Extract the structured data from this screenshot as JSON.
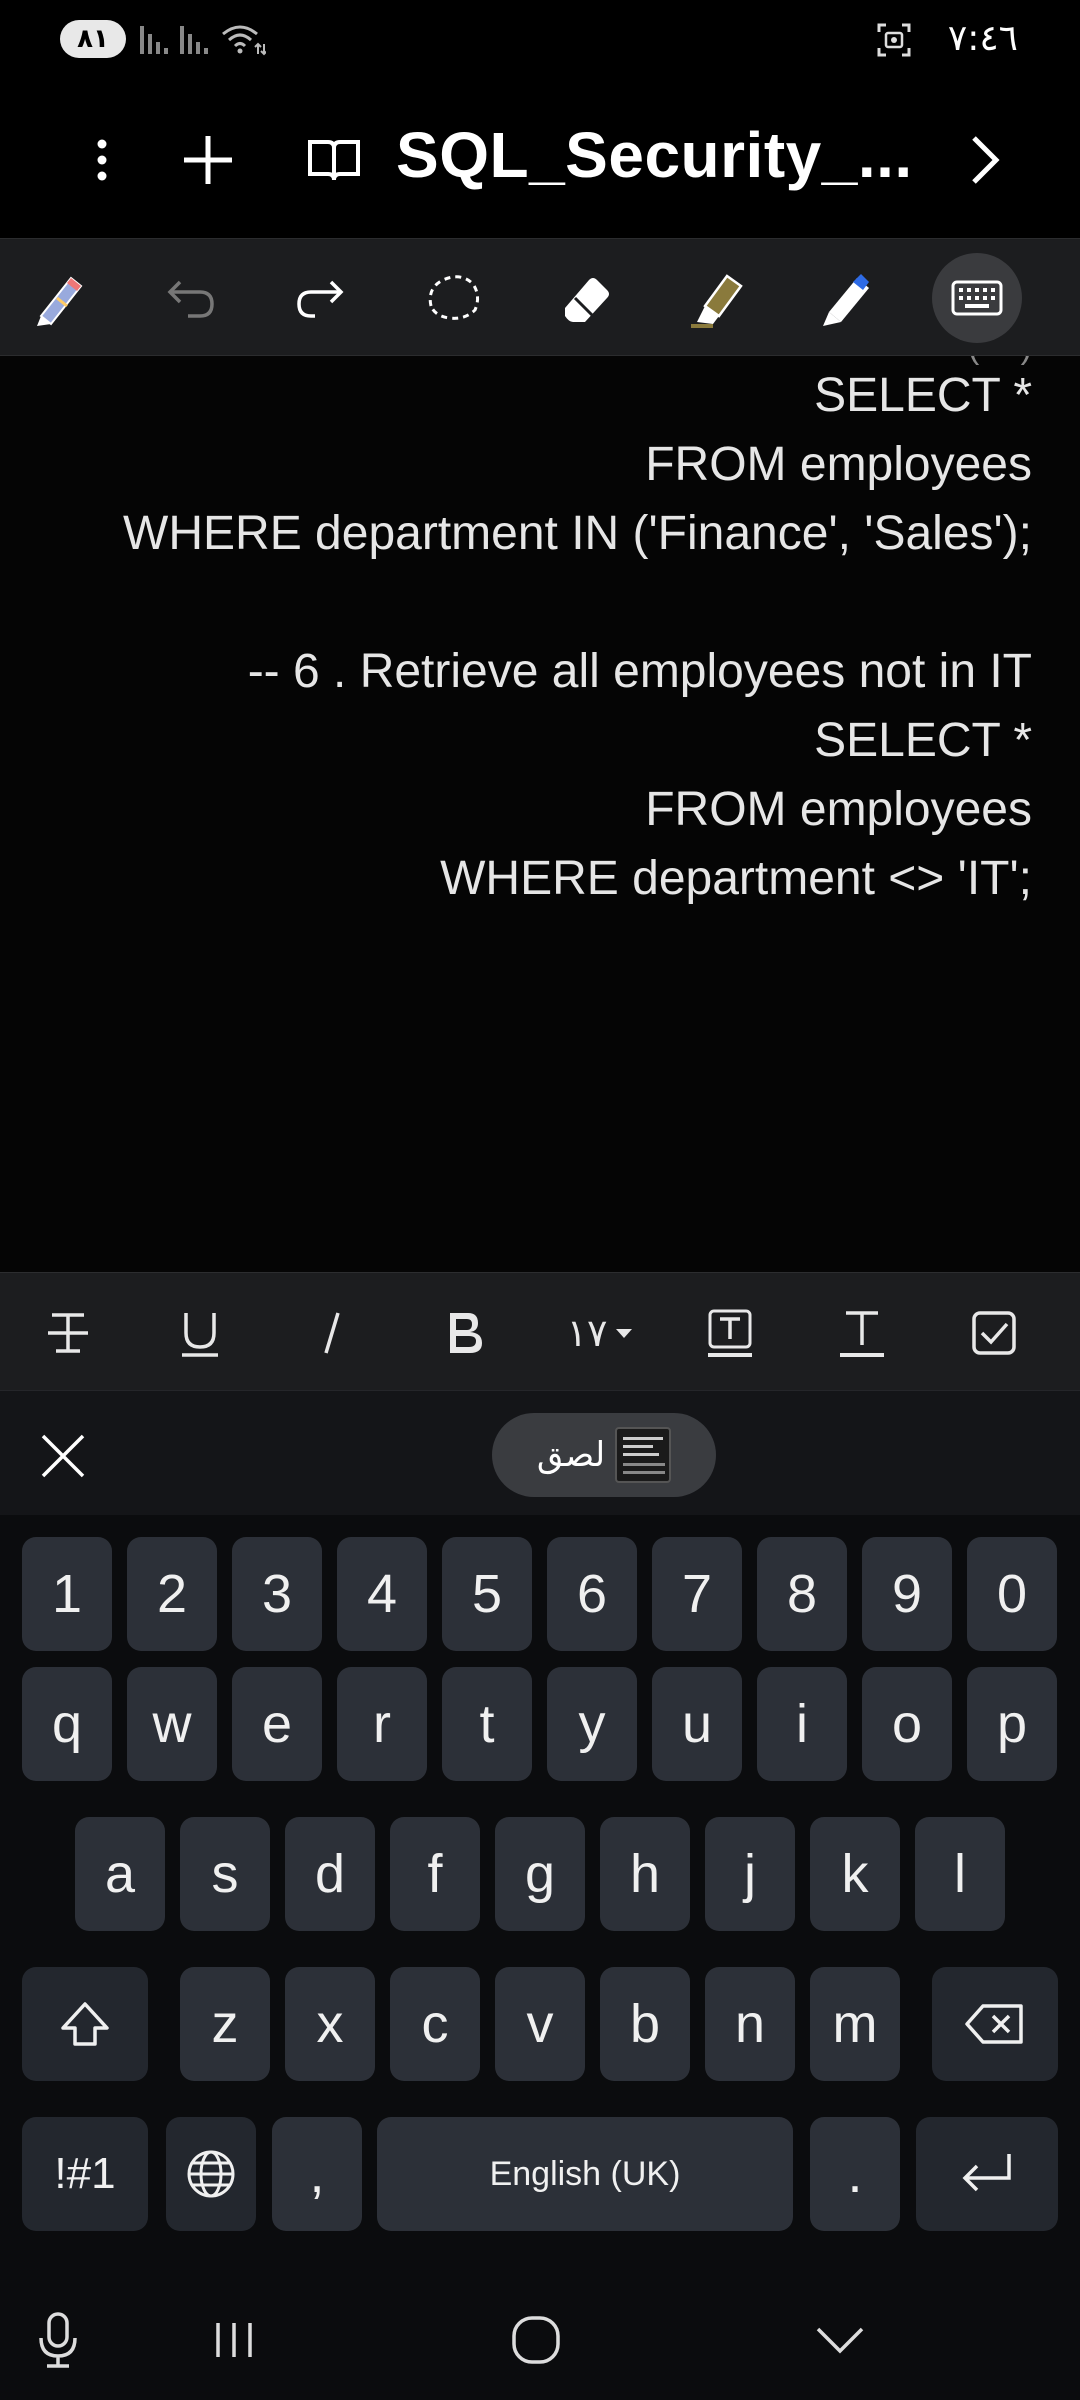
{
  "status_bar": {
    "battery": "٨١",
    "time": "٧:٤٦"
  },
  "app_bar": {
    "title": "SQL_Security_..."
  },
  "note": {
    "lines": [
      "SELECT *",
      "FROM employees",
      "WHERE department IN ('Finance', 'Sales');",
      "",
      "-- 6 . Retrieve all employees not in IT",
      "SELECT *",
      "FROM employees",
      "WHERE department <> 'IT';"
    ]
  },
  "format_bar": {
    "font_size": "١٧"
  },
  "keyboard": {
    "paste_label": "لصق",
    "rows": {
      "numbers": [
        "1",
        "2",
        "3",
        "4",
        "5",
        "6",
        "7",
        "8",
        "9",
        "0"
      ],
      "row1": [
        "q",
        "w",
        "e",
        "r",
        "t",
        "y",
        "u",
        "i",
        "o",
        "p"
      ],
      "row2": [
        "a",
        "s",
        "d",
        "f",
        "g",
        "h",
        "j",
        "k",
        "l"
      ],
      "row3": [
        "z",
        "x",
        "c",
        "v",
        "b",
        "n",
        "m"
      ]
    },
    "symbols_label": "!#1",
    "comma": ",",
    "period": ".",
    "space_label": "English (UK)"
  },
  "colors": {
    "background": "#000000",
    "toolbar": "#1c1d1f",
    "key": "#2c3038",
    "highlighter": "#8a7a3c",
    "pen_blue": "#2e6be6"
  }
}
